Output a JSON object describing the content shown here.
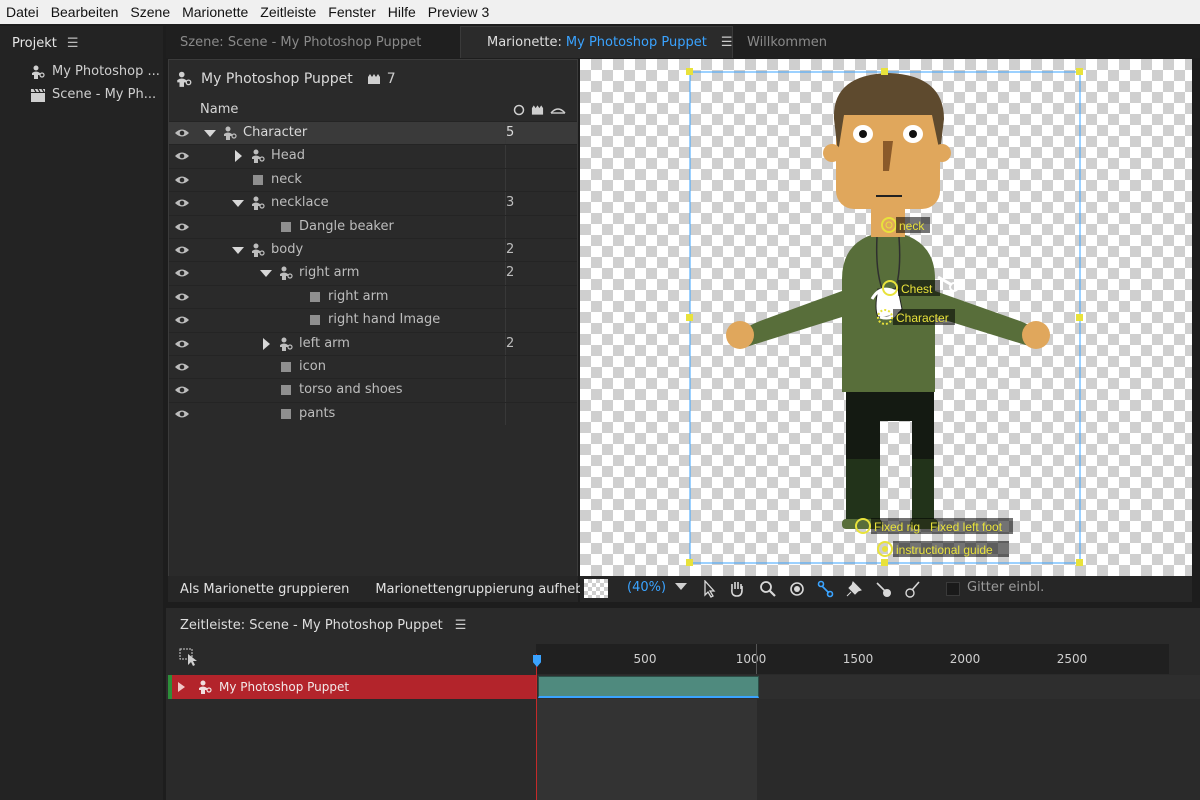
{
  "menubar": {
    "items": [
      "Datei",
      "Bearbeiten",
      "Szene",
      "Marionette",
      "Zeitleiste",
      "Fenster",
      "Hilfe",
      "Preview 3"
    ]
  },
  "project": {
    "title": "Projekt",
    "items": [
      {
        "label": "My Photoshop ...",
        "icon": "puppet-icon"
      },
      {
        "label": "Scene - My Ph...",
        "icon": "clapperboard-icon"
      }
    ]
  },
  "tabs": {
    "scene": "Szene: Scene - My Photoshop Puppet",
    "puppet_prefix": "Marionette:",
    "puppet_link": "My Photoshop Puppet",
    "welcome": "Willkommen"
  },
  "puppet_panel": {
    "title": "My Photoshop Puppet",
    "count": "7",
    "column_name": "Name",
    "rows": [
      {
        "label": "Character",
        "count": "5",
        "expand": "down",
        "type": "group",
        "depth": 0,
        "selected": true
      },
      {
        "label": "Head",
        "count": "",
        "expand": "right",
        "type": "group",
        "depth": 1
      },
      {
        "label": "neck",
        "count": "",
        "expand": "none",
        "type": "layer",
        "depth": 1
      },
      {
        "label": "necklace",
        "count": "3",
        "expand": "down",
        "type": "group",
        "depth": 1
      },
      {
        "label": "Dangle beaker",
        "count": "",
        "expand": "none",
        "type": "layer",
        "depth": 2
      },
      {
        "label": "body",
        "count": "2",
        "expand": "down",
        "type": "group",
        "depth": 1
      },
      {
        "label": "right arm",
        "count": "2",
        "expand": "down",
        "type": "group",
        "depth": 2
      },
      {
        "label": "right arm",
        "count": "",
        "expand": "none",
        "type": "layer",
        "depth": 3
      },
      {
        "label": "right hand Image",
        "count": "",
        "expand": "none",
        "type": "layer",
        "depth": 3
      },
      {
        "label": "left arm",
        "count": "2",
        "expand": "right",
        "type": "group",
        "depth": 2
      },
      {
        "label": "icon",
        "count": "",
        "expand": "none",
        "type": "layer",
        "depth": 2
      },
      {
        "label": "torso and shoes",
        "count": "",
        "expand": "none",
        "type": "layer",
        "depth": 2
      },
      {
        "label": "pants",
        "count": "",
        "expand": "none",
        "type": "layer",
        "depth": 2
      }
    ],
    "btn_group": "Als Marionette gruppieren",
    "btn_ungroup": "Marionettengruppierung aufheben"
  },
  "canvas": {
    "handles": {
      "neck": "neck",
      "chest": "Chest",
      "character": "Character",
      "fixed_right": "Fixed rig",
      "fixed_left": "Fixed left foot",
      "guide": "instructional guide"
    },
    "zoom": "(40%)",
    "grid_label": "Gitter einbl.",
    "colors": {
      "shirt": "#586e3a",
      "skin": "#e0a75c",
      "hair": "#5e4a2e",
      "pants": "#141a12",
      "selection": "#3aa3ff",
      "handle": "#e8e23b"
    }
  },
  "timeline": {
    "title": "Zeitleiste: Scene - My Photoshop Puppet",
    "ticks": [
      "500",
      "1000",
      "1500",
      "2000",
      "2500"
    ],
    "track_label": "My Photoshop Puppet",
    "accent": "#b3242b",
    "clip_color": "#4f8a7e"
  }
}
